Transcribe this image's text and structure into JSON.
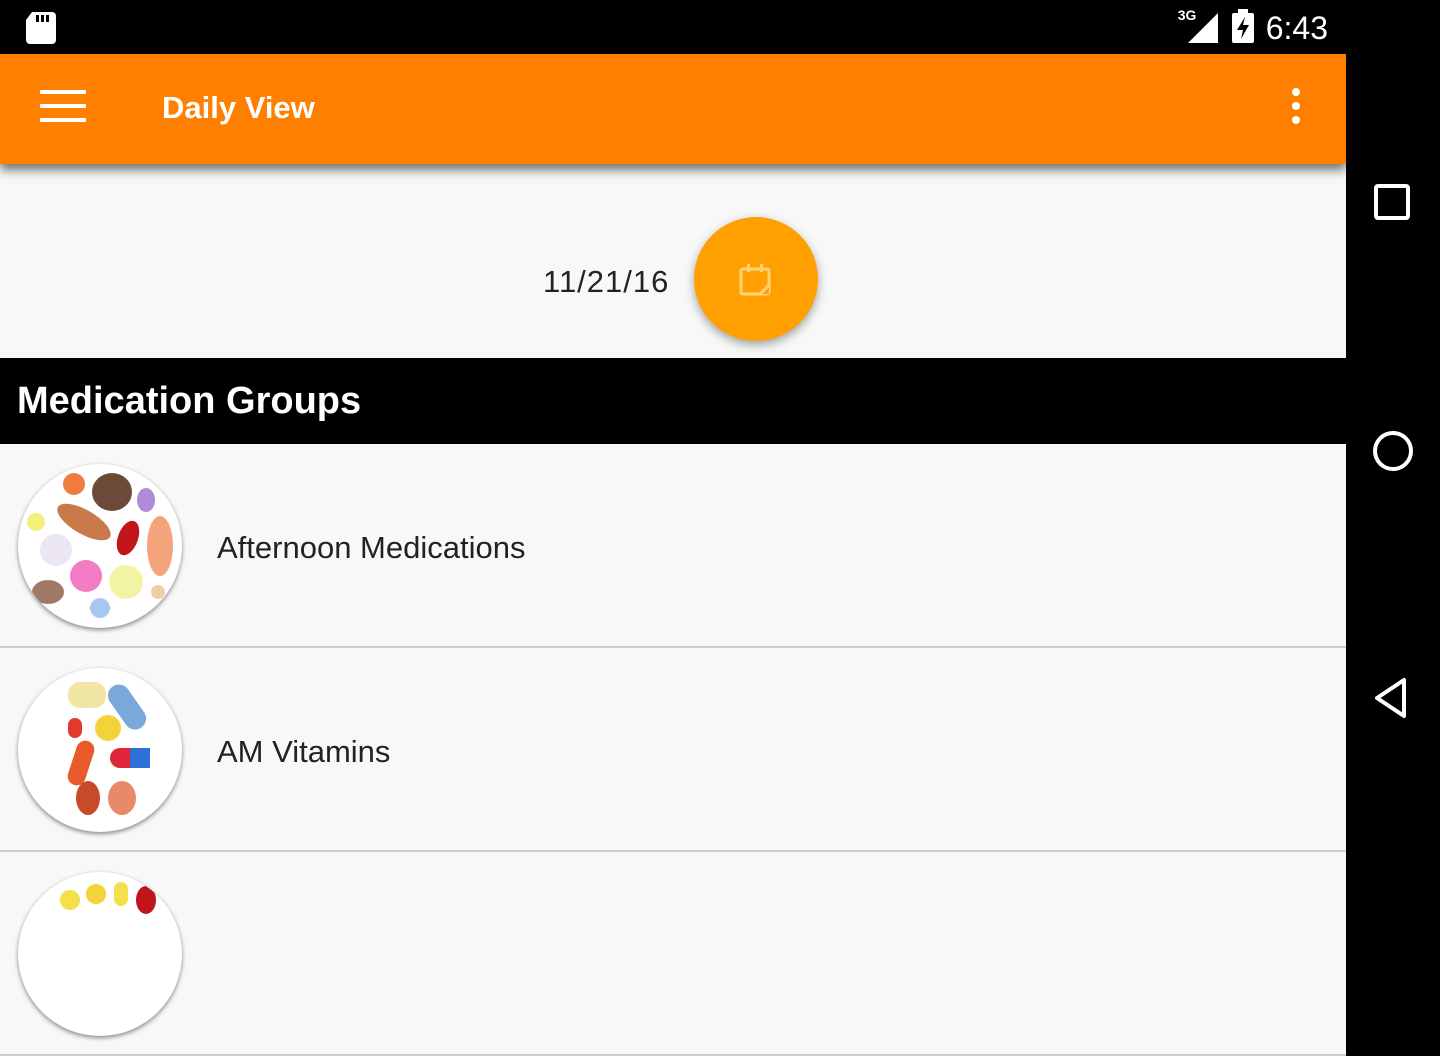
{
  "status_bar": {
    "time": "6:43",
    "network_label": "3G",
    "icons": [
      "sd-card-icon",
      "signal-icon",
      "battery-charging-icon"
    ]
  },
  "app_bar": {
    "title": "Daily View",
    "menu_icon": "hamburger-menu-icon",
    "overflow_icon": "more-vert-icon",
    "color": "#ff7f00"
  },
  "date_selector": {
    "date": "11/21/16",
    "button_icon": "calendar-icon",
    "button_color": "#ffa000"
  },
  "section": {
    "title": "Medication Groups"
  },
  "groups": [
    {
      "name": "Afternoon Medications",
      "image": "assorted-pills-image"
    },
    {
      "name": "AM Vitamins",
      "image": "vitamin-capsules-image"
    },
    {
      "name": "",
      "image": "pills-image"
    }
  ],
  "nav_bar": {
    "buttons": [
      "recents-square-icon",
      "home-circle-icon",
      "back-triangle-icon"
    ]
  }
}
